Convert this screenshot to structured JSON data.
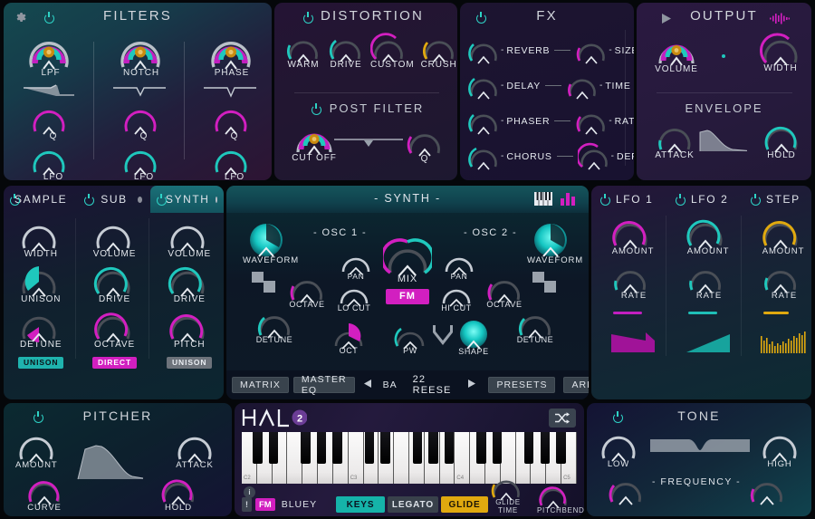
{
  "filters": {
    "title": "FILTERS",
    "power": "power-icon",
    "gear": "gear-icon",
    "columns": [
      {
        "main": "LPF",
        "q": "Q",
        "lfo": "LFO"
      },
      {
        "main": "NOTCH",
        "q": "Q",
        "lfo": "LFO"
      },
      {
        "main": "PHASE",
        "q": "Q",
        "lfo": "LFO"
      }
    ]
  },
  "distortion": {
    "title": "DISTORTION",
    "knobs": [
      "WARM",
      "DRIVE",
      "CUSTOM",
      "CRUSH"
    ],
    "post_filter": {
      "title": "POST FILTER",
      "cutoff": "CUT OFF",
      "q": "Q"
    }
  },
  "fx": {
    "title": "FX",
    "rows": [
      {
        "left": "REVERB",
        "right": "SIZE"
      },
      {
        "left": "DELAY",
        "right": "TIME"
      },
      {
        "left": "PHASER",
        "right": "RATE"
      },
      {
        "left": "CHORUS",
        "right": "DEPTH"
      }
    ]
  },
  "output": {
    "title": "OUTPUT",
    "play": "play-icon",
    "wave": "waveform-icon",
    "volume": "VOLUME",
    "width": "WIDTH",
    "envelope": {
      "title": "ENVELOPE",
      "attack": "ATTACK",
      "hold": "HOLD"
    }
  },
  "sources": {
    "tabs": [
      {
        "name": "SAMPLE",
        "active": false
      },
      {
        "name": "SUB",
        "active": false
      },
      {
        "name": "SYNTH",
        "active": true
      }
    ],
    "sample": {
      "k1": "WIDTH",
      "k2": "UNISON",
      "k3": "DETUNE",
      "tag": "UNISON"
    },
    "sub": {
      "k1": "VOLUME",
      "k2": "DRIVE",
      "k3": "OCTAVE",
      "tag": "DIRECT"
    },
    "synth": {
      "k1": "VOLUME",
      "k2": "DRIVE",
      "k3": "PITCH",
      "tag": "UNISON"
    }
  },
  "synth": {
    "title": "- SYNTH -",
    "keys_icon": "piano-keys-icon",
    "bars_icon": "bar-meter-icon",
    "osc1": {
      "title": "- OSC 1 -",
      "waveform": "WAVEFORM",
      "pan": "PAN",
      "octave": "OCTAVE",
      "detune": "DETUNE",
      "locut": "LO CUT"
    },
    "osc2": {
      "title": "- OSC 2 -",
      "waveform": "WAVEFORM",
      "pan": "PAN",
      "octave": "OCTAVE",
      "detune": "DETUNE",
      "hicut": "HI CUT"
    },
    "mix": "MIX",
    "fm_button": "FM",
    "oct": "OCT",
    "pw": "PW",
    "shape": "SHAPE",
    "toolbar": {
      "matrix": "MATRIX",
      "master_eq": "MASTER EQ",
      "prev": "prev-arrow-icon",
      "next": "next-arrow-icon",
      "bank": "BA",
      "preset_name": "22 REESE",
      "presets": "PRESETS",
      "arp": "ARP"
    }
  },
  "modulators": {
    "columns": [
      {
        "name": "LFO 1",
        "amount": "AMOUNT",
        "rate": "RATE",
        "color": "#d21fc0"
      },
      {
        "name": "LFO 2",
        "amount": "AMOUNT",
        "rate": "RATE",
        "color": "#1fbfb7"
      },
      {
        "name": "STEP",
        "amount": "AMOUNT",
        "rate": "RATE",
        "color": "#e0a90f"
      }
    ]
  },
  "pitcher": {
    "title": "PITCHER",
    "amount": "AMOUNT",
    "curve": "CURVE",
    "attack": "ATTACK",
    "hold": "HOLD"
  },
  "halo": {
    "logo": "HALO",
    "version": "2",
    "shuffle": "shuffle-icon",
    "info": "info-icon",
    "warn": "warning-icon",
    "fm_badge": "FM",
    "patch_name": "BLUEY",
    "buttons": [
      {
        "label": "KEYS",
        "state": "on-teal"
      },
      {
        "label": "LEGATO",
        "state": "off"
      },
      {
        "label": "GLIDE",
        "state": "on-amber"
      }
    ],
    "glide_time": "GLIDE TIME",
    "pitchbend": "PITCHBEND",
    "key_markers": [
      "C2",
      "C3",
      "C4",
      "C5"
    ]
  },
  "tone": {
    "title": "TONE",
    "low": "LOW",
    "high": "HIGH",
    "frequency": "- FREQUENCY -"
  },
  "colors": {
    "teal": "#1fc8bd",
    "magenta": "#d21fc0",
    "amber": "#e0a90f",
    "gray": "#9aa0a8",
    "white": "#e6eaef"
  }
}
